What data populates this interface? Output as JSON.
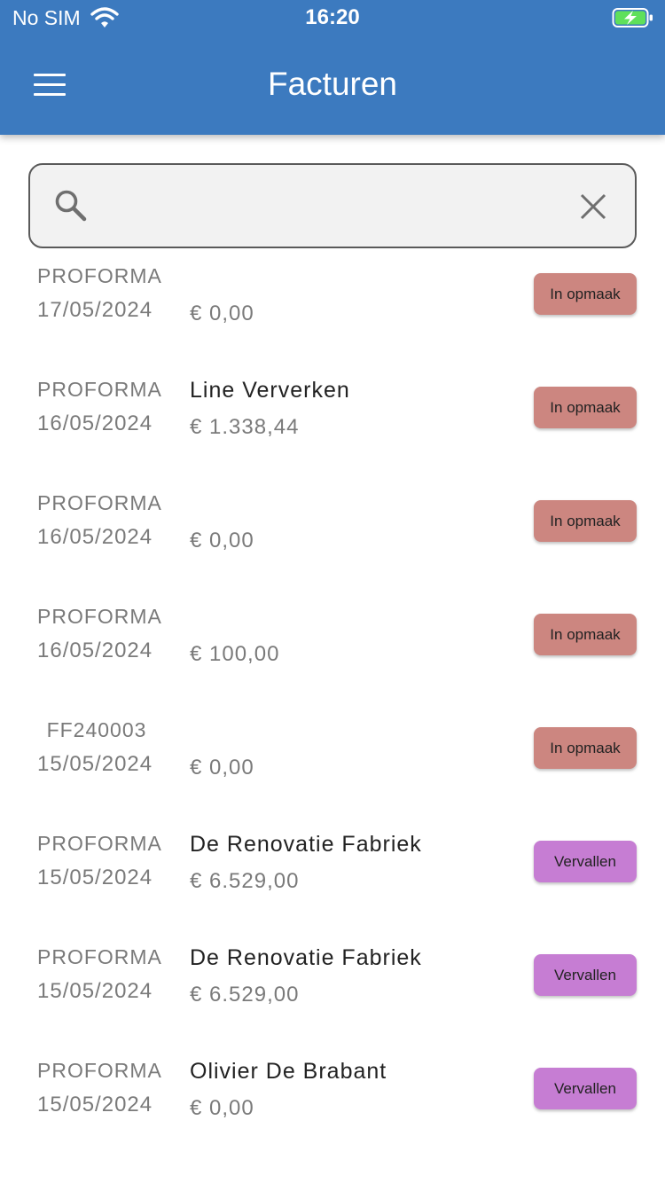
{
  "status_bar": {
    "carrier": "No SIM",
    "time": "16:20"
  },
  "header": {
    "title": "Facturen",
    "color": "#3c7abf"
  },
  "search": {
    "value": "",
    "placeholder": ""
  },
  "invoices": [
    {
      "type": "PROFORMA",
      "date": "17/05/2024",
      "client": "",
      "amount": "€ 0,00",
      "status": "In opmaak",
      "status_kind": "draft"
    },
    {
      "type": "PROFORMA",
      "date": "16/05/2024",
      "client": "Line Ververken",
      "amount": "€ 1.338,44",
      "status": "In opmaak",
      "status_kind": "draft"
    },
    {
      "type": "PROFORMA",
      "date": "16/05/2024",
      "client": "",
      "amount": "€ 0,00",
      "status": "In opmaak",
      "status_kind": "draft"
    },
    {
      "type": "PROFORMA",
      "date": "16/05/2024",
      "client": "",
      "amount": "€ 100,00",
      "status": "In opmaak",
      "status_kind": "draft"
    },
    {
      "type": "FF240003",
      "date": "15/05/2024",
      "client": "",
      "amount": "€ 0,00",
      "status": "In opmaak",
      "status_kind": "draft"
    },
    {
      "type": "PROFORMA",
      "date": "15/05/2024",
      "client": "De Renovatie Fabriek",
      "amount": "€ 6.529,00",
      "status": "Vervallen",
      "status_kind": "expired"
    },
    {
      "type": "PROFORMA",
      "date": "15/05/2024",
      "client": "De Renovatie Fabriek",
      "amount": "€ 6.529,00",
      "status": "Vervallen",
      "status_kind": "expired"
    },
    {
      "type": "PROFORMA",
      "date": "15/05/2024",
      "client": "Olivier De Brabant",
      "amount": "€ 0,00",
      "status": "Vervallen",
      "status_kind": "expired"
    }
  ],
  "status_colors": {
    "draft": "#cc8680",
    "expired": "#c67dd3"
  }
}
